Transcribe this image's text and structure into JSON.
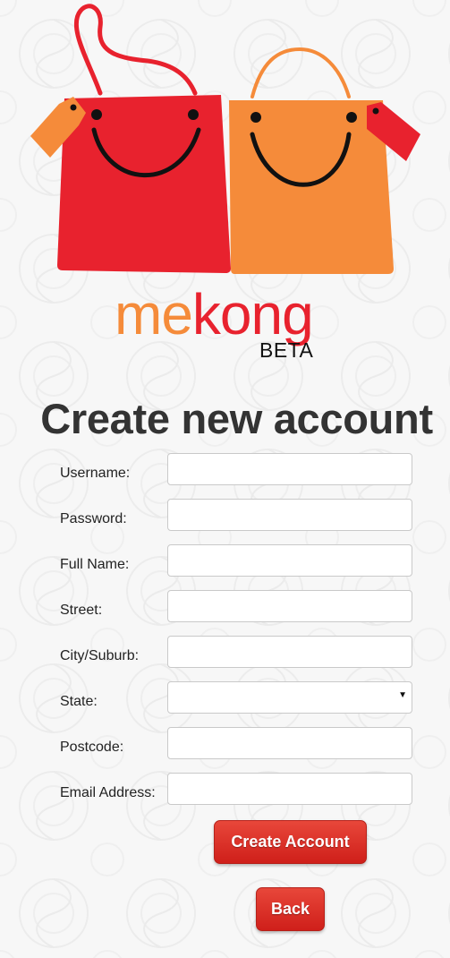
{
  "brand": {
    "name_part1": "me",
    "name_part2": "kong",
    "tag": "BETA",
    "colors": {
      "orange": "#f58b3a",
      "red": "#e8222e"
    }
  },
  "page_title": "Create new account",
  "form": {
    "fields": [
      {
        "label": "Username:",
        "value": "",
        "type": "text"
      },
      {
        "label": "Password:",
        "value": "",
        "type": "password"
      },
      {
        "label": "Full Name:",
        "value": "",
        "type": "text"
      },
      {
        "label": "Street:",
        "value": "",
        "type": "text"
      },
      {
        "label": "City/Suburb:",
        "value": "",
        "type": "text"
      },
      {
        "label": "State:",
        "value": "",
        "type": "select"
      },
      {
        "label": "Postcode:",
        "value": "",
        "type": "text"
      },
      {
        "label": "Email Address:",
        "value": "",
        "type": "text"
      }
    ]
  },
  "buttons": {
    "create_label": "Create Account",
    "back_label": "Back"
  },
  "icons": {
    "logo": "smiling-shopping-bags-icon",
    "dropdown": "caret-down-icon"
  }
}
